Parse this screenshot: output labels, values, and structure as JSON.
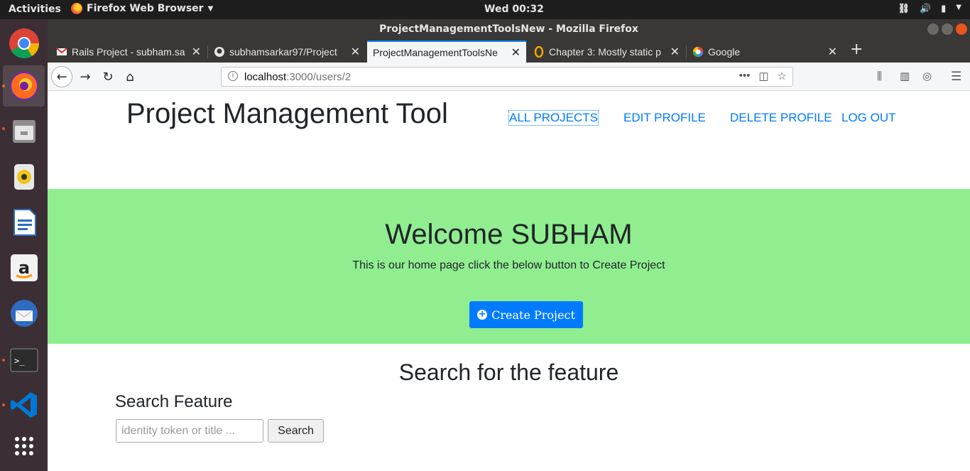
{
  "system_bar": {
    "activities": "Activities",
    "app_menu": "Firefox Web Browser",
    "clock": "Wed 00:32"
  },
  "dock": {
    "apps": [
      {
        "name": "chrome-icon",
        "color": "#4285f4"
      },
      {
        "name": "firefox-icon",
        "color": "#ff6a1f"
      },
      {
        "name": "files-icon",
        "color": "#a6a6a6"
      },
      {
        "name": "rhythmbox-icon",
        "color": "#f0c419"
      },
      {
        "name": "libreoffice-writer-icon",
        "color": "#2a6ebb"
      },
      {
        "name": "amazon-icon",
        "color": "#ff9900"
      },
      {
        "name": "thunderbird-icon",
        "color": "#2f6cc0"
      },
      {
        "name": "terminal-icon",
        "color": "#2c2c2c"
      },
      {
        "name": "vscode-icon",
        "color": "#0078d7"
      },
      {
        "name": "show-apps-icon",
        "color": "#ffffff"
      }
    ]
  },
  "window": {
    "title": "ProjectManagementToolsNew - Mozilla Firefox"
  },
  "tabs": [
    {
      "title": "Rails Project - subham.sa",
      "favicon": "gmail-icon"
    },
    {
      "title": "subhamsarkar97/Project",
      "favicon": "github-icon"
    },
    {
      "title": "ProjectManagementToolsNe",
      "favicon": "",
      "active": true
    },
    {
      "title": "Chapter 3: Mostly static p",
      "favicon": "oreilly-icon"
    },
    {
      "title": "Google",
      "favicon": "google-icon"
    }
  ],
  "urlbar": {
    "host": "localhost",
    "path": ":3000/users/2"
  },
  "site": {
    "brand": "Project Management Tool",
    "nav": {
      "all_projects": "ALL PROJECTS",
      "edit_profile": "EDIT PROFILE",
      "delete_profile": "DELETE PROFILE",
      "log_out": "LOG OUT"
    },
    "hero": {
      "heading": "Welcome SUBHAM",
      "text": "This is our home page click the below button to Create Project",
      "button": "Create Project",
      "background": "#90ee90"
    },
    "search": {
      "title": "Search for the feature",
      "label": "Search Feature",
      "placeholder": "identity token or title ...",
      "button": "Search"
    },
    "accent": "#007bff"
  }
}
